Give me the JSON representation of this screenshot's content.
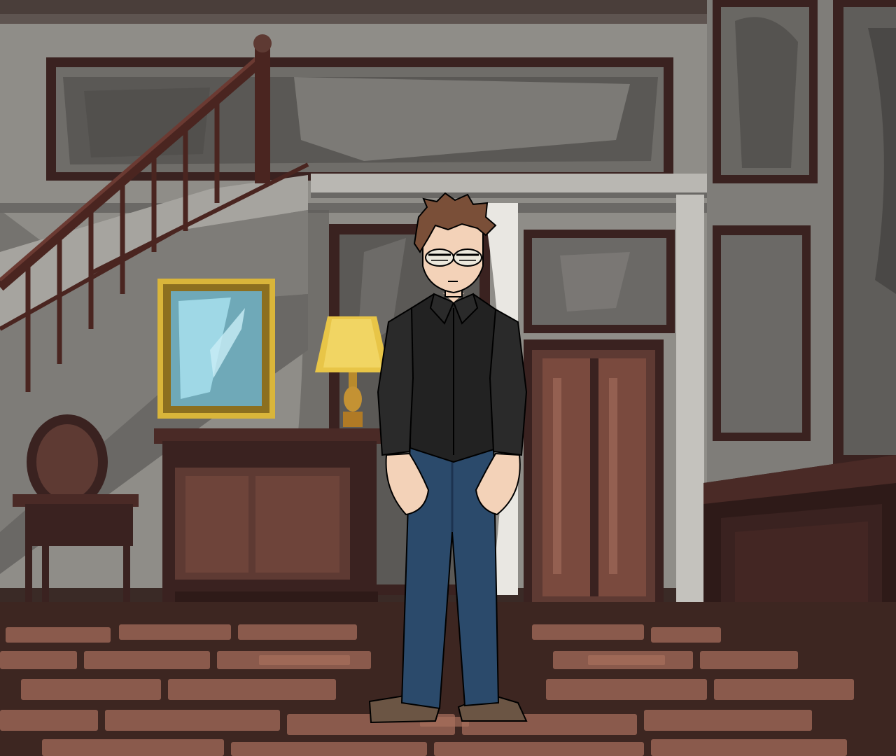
{
  "scene": {
    "type": "visual-novel-background",
    "location": "old-house-hallway",
    "palette": {
      "wall": "#8f8d88",
      "wall_shadow": "#6a6865",
      "wood_dark": "#3a2220",
      "wood_mid": "#5e3a33",
      "floor_light": "#8a5a4c",
      "floor_dark": "#3d2621",
      "lamp_shade": "#e8c547",
      "frame_gold": "#d9b53a",
      "mirror_glass": "#9fd8e6"
    }
  },
  "character": {
    "hair_color": "#7a4f38",
    "shirt_color": "#222222",
    "jeans_color": "#2b4a6b",
    "skin_color": "#f3d2b8",
    "shoe_color": "#6b5544"
  }
}
